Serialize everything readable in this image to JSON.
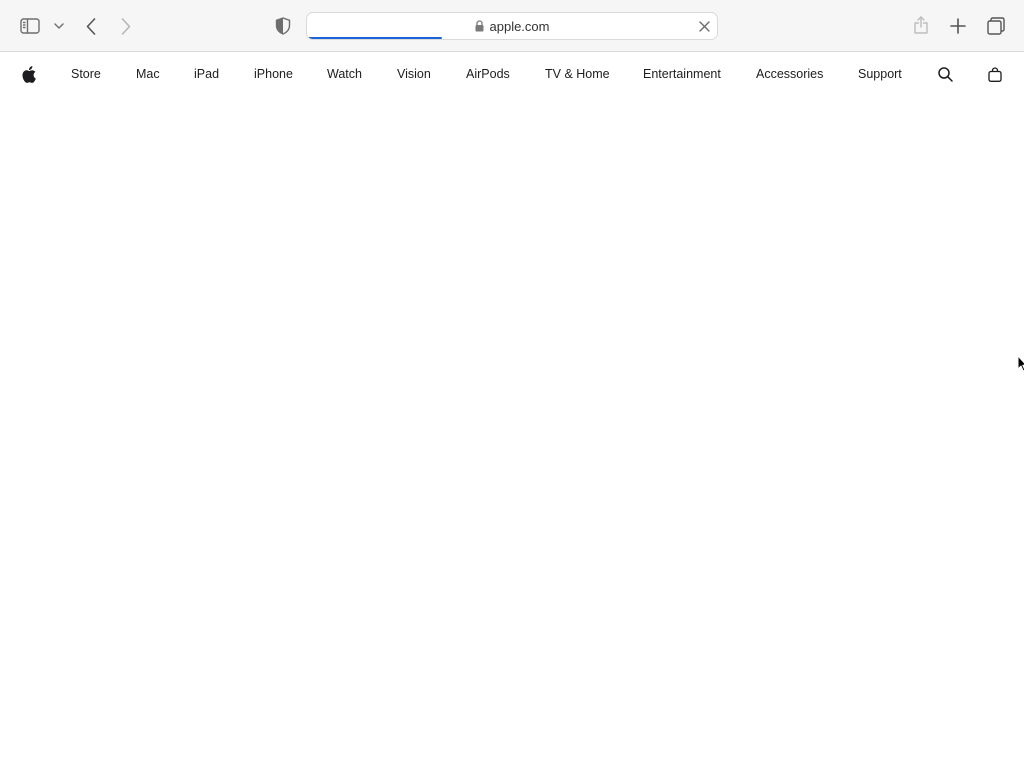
{
  "browser": {
    "url": "apple.com",
    "load_progress": 0.33,
    "accent_color": "#1a63d8",
    "icons": {
      "sidebar": "sidebar-icon",
      "sidebar_menu": "chevron-down-icon",
      "back": "chevron-left-icon",
      "forward": "chevron-right-icon",
      "privacy": "shield-icon",
      "lock": "lock-icon",
      "stop": "close-icon",
      "share": "share-icon",
      "new_tab": "plus-icon",
      "tabs": "tabs-overview-icon"
    }
  },
  "globalnav": {
    "logo": "apple-logo-icon",
    "items": [
      {
        "label": "Store"
      },
      {
        "label": "Mac"
      },
      {
        "label": "iPad"
      },
      {
        "label": "iPhone"
      },
      {
        "label": "Watch"
      },
      {
        "label": "Vision"
      },
      {
        "label": "AirPods"
      },
      {
        "label": "TV & Home"
      },
      {
        "label": "Entertainment"
      },
      {
        "label": "Accessories"
      },
      {
        "label": "Support"
      }
    ],
    "icons": {
      "search": "search-icon",
      "bag": "bag-icon"
    }
  }
}
